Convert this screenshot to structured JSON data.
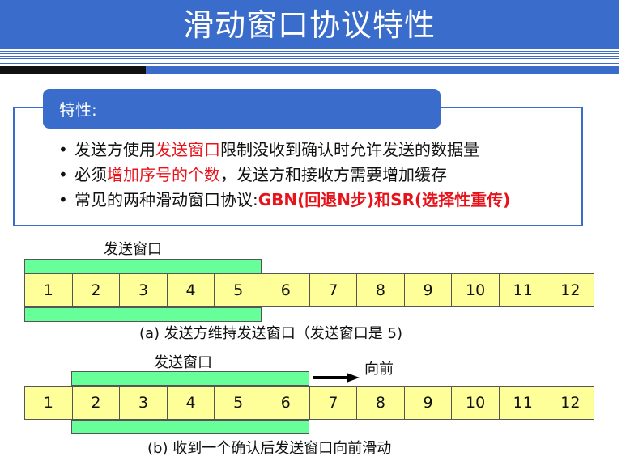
{
  "header": {
    "title": "滑动窗口协议特性"
  },
  "features": {
    "tab_label": "特性:",
    "bullets": [
      {
        "segments": [
          {
            "text": "发送方使用",
            "style": "normal"
          },
          {
            "text": "发送窗口",
            "style": "red"
          },
          {
            "text": "限制没收到确认时允许发送的数据量",
            "style": "normal"
          }
        ]
      },
      {
        "segments": [
          {
            "text": "必须",
            "style": "normal"
          },
          {
            "text": "增加序号的个数",
            "style": "red"
          },
          {
            "text": "，发送方和接收方需要增加缓存",
            "style": "normal"
          }
        ]
      },
      {
        "segments": [
          {
            "text": "常见的两种滑动窗口协议:",
            "style": "normal"
          },
          {
            "text": "GBN(回退N步)和SR(选择性重传)",
            "style": "red-bold"
          }
        ]
      }
    ]
  },
  "diagram_a": {
    "window_label": "发送窗口",
    "sequence": [
      "1",
      "2",
      "3",
      "4",
      "5",
      "6",
      "7",
      "8",
      "9",
      "10",
      "11",
      "12"
    ],
    "caption": "(a) 发送方维持发送窗口（发送窗口是 5)"
  },
  "diagram_b": {
    "window_label": "发送窗口",
    "forward_label": "向前",
    "sequence": [
      "1",
      "2",
      "3",
      "4",
      "5",
      "6",
      "7",
      "8",
      "9",
      "10",
      "11",
      "12"
    ],
    "caption": "(b) 收到一个确认后发送窗口向前滑动"
  },
  "colors": {
    "header_blue": "#3a6ccc",
    "highlight_red": "#e8121a",
    "cell_yellow": "#ffff99",
    "window_green": "#66ff99"
  }
}
